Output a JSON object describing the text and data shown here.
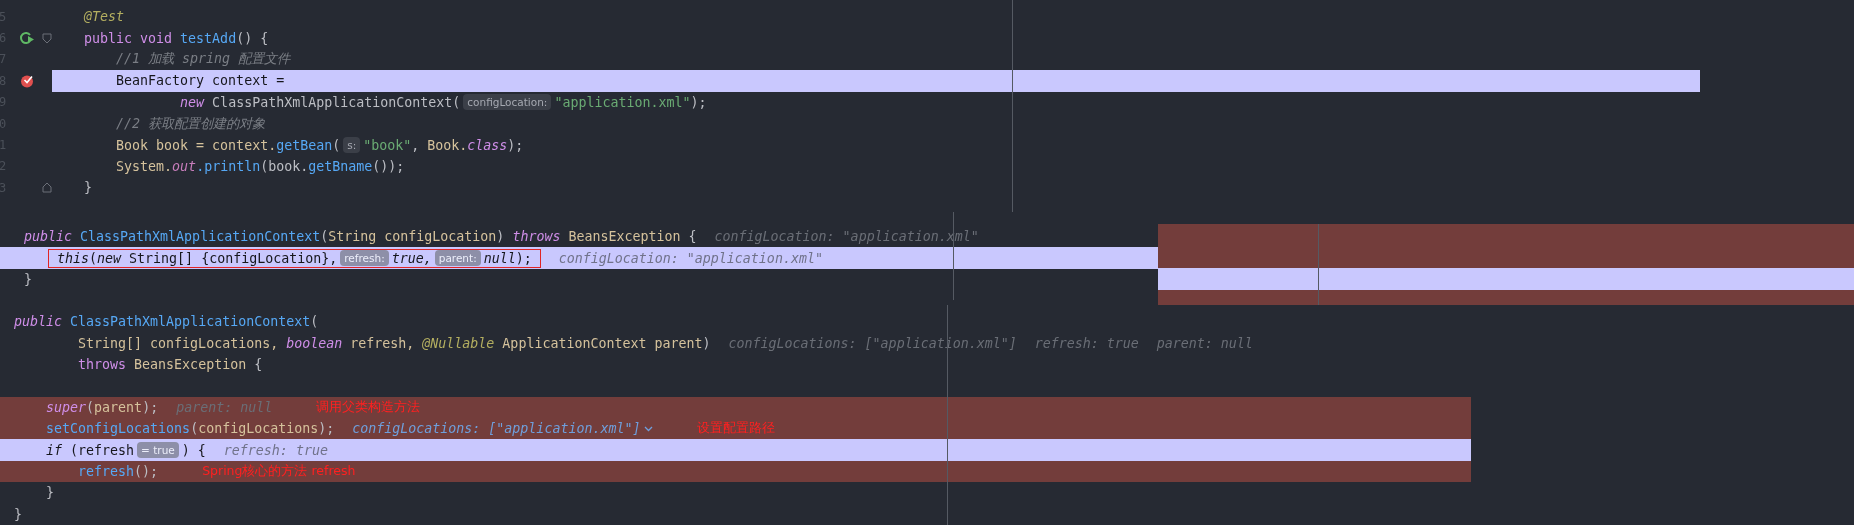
{
  "panels": [
    {
      "kind": "numbered",
      "lines": [
        {
          "number": "5",
          "segments": [
            {
              "kind": "annotation",
              "text": "    @Test"
            }
          ]
        },
        {
          "number": "6",
          "run_marker": true,
          "fold_open": true,
          "segments": [
            {
              "kind": "keyword",
              "text": "    public void "
            },
            {
              "kind": "method",
              "text": "testAdd"
            },
            {
              "kind": "plain",
              "text": "() {"
            }
          ]
        },
        {
          "number": "7",
          "segments": [
            {
              "kind": "comment",
              "text": "        //1 加载 spring 配置文件"
            }
          ]
        },
        {
          "number": "8",
          "breakpoint": true,
          "current": true,
          "segments": [
            {
              "kind": "plain",
              "text": "        BeanFactory context ="
            }
          ]
        },
        {
          "number": "9",
          "segments": [
            {
              "kind": "keyword-italic",
              "text": "                new"
            },
            {
              "kind": "plain",
              "text": " ClassPathXmlApplicationContext("
            },
            {
              "kind": "param-hint",
              "text": "configLocation:"
            },
            {
              "kind": "string",
              "text": "\"application.xml\""
            },
            {
              "kind": "plain",
              "text": ");"
            }
          ]
        },
        {
          "number": "0",
          "segments": [
            {
              "kind": "comment",
              "text": "        //2 获取配置创建的对象"
            }
          ]
        },
        {
          "number": "1",
          "segments": [
            {
              "kind": "variable",
              "text": "        Book book = context."
            },
            {
              "kind": "method",
              "text": "getBean"
            },
            {
              "kind": "plain",
              "text": "("
            },
            {
              "kind": "param-hint",
              "text": "s:"
            },
            {
              "kind": "string",
              "text": "\"book\""
            },
            {
              "kind": "plain",
              "text": ", "
            },
            {
              "kind": "variable",
              "text": "Book."
            },
            {
              "kind": "keyword-italic",
              "text": "class"
            },
            {
              "kind": "plain",
              "text": ");"
            }
          ]
        },
        {
          "number": "2",
          "segments": [
            {
              "kind": "variable",
              "text": "        System."
            },
            {
              "kind": "field",
              "text": "out"
            },
            {
              "kind": "method",
              "text": ".println"
            },
            {
              "kind": "plain",
              "text": "(book."
            },
            {
              "kind": "method",
              "text": "getBname"
            },
            {
              "kind": "plain",
              "text": "());"
            }
          ]
        },
        {
          "number": "3",
          "fold_close": true,
          "segments": [
            {
              "kind": "plain",
              "text": "    }"
            }
          ]
        }
      ]
    },
    {
      "kind": "split",
      "lines": [
        {
          "segments": [
            {
              "kind": "keyword-italic",
              "text": "public "
            },
            {
              "kind": "method",
              "text": "ClassPathXmlApplicationContext"
            },
            {
              "kind": "plain",
              "text": "("
            },
            {
              "kind": "variable",
              "text": "String configLocation"
            },
            {
              "kind": "plain",
              "text": ") "
            },
            {
              "kind": "keyword-italic",
              "text": "throws"
            },
            {
              "kind": "variable",
              "text": " BeansException"
            },
            {
              "kind": "plain",
              "text": " {"
            },
            {
              "kind": "inline-value",
              "text": "configLocation: \"application.xml\""
            }
          ]
        },
        {
          "current": true,
          "segments": [
            {
              "kind": "outlined",
              "parts": [
                {
                  "kind": "keyword-italic",
                  "text": "this"
                },
                {
                  "kind": "plain",
                  "text": "("
                },
                {
                  "kind": "keyword-italic",
                  "text": "new"
                },
                {
                  "kind": "plain",
                  "text": " String[] {configLocation},"
                },
                {
                  "kind": "param-hint",
                  "text": "refresh:"
                },
                {
                  "kind": "keyword-italic",
                  "text": "true,"
                },
                {
                  "kind": "param-hint",
                  "text": "parent:"
                },
                {
                  "kind": "keyword-italic",
                  "text": "null"
                },
                {
                  "kind": "plain",
                  "text": ");"
                }
              ]
            },
            {
              "kind": "inline-value",
              "text": "configLocation: \"application.xml\""
            }
          ]
        },
        {
          "segments": [
            {
              "kind": "plain",
              "text": "}"
            }
          ]
        }
      ]
    },
    {
      "kind": "plain",
      "lines": [
        {
          "segments": [
            {
              "kind": "keyword-italic",
              "text": "public "
            },
            {
              "kind": "method",
              "text": "ClassPathXmlApplicationContext"
            },
            {
              "kind": "plain",
              "text": "("
            }
          ]
        },
        {
          "segments": [
            {
              "kind": "variable",
              "text": "        String[] configLocations, "
            },
            {
              "kind": "keyword-italic",
              "text": "boolean"
            },
            {
              "kind": "variable",
              "text": " refresh, "
            },
            {
              "kind": "annotation",
              "text": "@Nullable"
            },
            {
              "kind": "variable",
              "text": " ApplicationContext parent"
            },
            {
              "kind": "plain",
              "text": ")"
            },
            {
              "kind": "inline-value",
              "text": "configLocations: [\"application.xml\"]"
            },
            {
              "kind": "inline-value",
              "text": "refresh: true"
            },
            {
              "kind": "inline-value",
              "text": "parent: null"
            }
          ]
        },
        {
          "segments": [
            {
              "kind": "keyword",
              "text": "        throws"
            },
            {
              "kind": "variable",
              "text": " BeansException"
            },
            {
              "kind": "plain",
              "text": " {"
            }
          ]
        },
        {
          "blank": true
        },
        {
          "marked": true,
          "segments": [
            {
              "kind": "keyword-italic",
              "text": "    super"
            },
            {
              "kind": "plain",
              "text": "("
            },
            {
              "kind": "variable",
              "text": "parent"
            },
            {
              "kind": "plain",
              "text": ");"
            },
            {
              "kind": "inline-value",
              "text": "parent: null"
            },
            {
              "kind": "note",
              "text": "调用父类构造方法"
            }
          ]
        },
        {
          "marked": true,
          "segments": [
            {
              "kind": "method",
              "text": "    setConfigLocations"
            },
            {
              "kind": "plain",
              "text": "("
            },
            {
              "kind": "variable",
              "text": "configLocations"
            },
            {
              "kind": "plain",
              "text": ");"
            },
            {
              "kind": "inline-value-changed",
              "text": "configLocations: [\"application.xml\"]"
            },
            {
              "kind": "expander"
            },
            {
              "kind": "note",
              "text": "设置配置路径"
            }
          ]
        },
        {
          "current": true,
          "segments": [
            {
              "kind": "keyword-italic",
              "text": "    if"
            },
            {
              "kind": "plain",
              "text": " (refresh"
            },
            {
              "kind": "value-hint",
              "text": "= true"
            },
            {
              "kind": "plain",
              "text": ") {"
            },
            {
              "kind": "inline-value",
              "text": "refresh: true"
            }
          ]
        },
        {
          "marked": true,
          "segments": [
            {
              "kind": "method",
              "text": "        refresh"
            },
            {
              "kind": "plain",
              "text": "();"
            },
            {
              "kind": "note",
              "text": "Spring核心的方法 refresh"
            }
          ]
        },
        {
          "segments": [
            {
              "kind": "plain",
              "text": "    }"
            }
          ]
        },
        {
          "segments": [
            {
              "kind": "plain",
              "text": "}"
            }
          ]
        }
      ]
    }
  ]
}
